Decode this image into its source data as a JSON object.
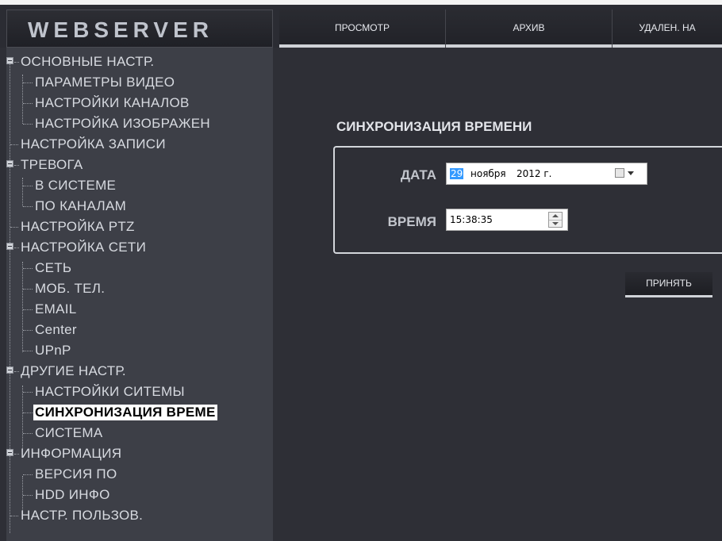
{
  "app": {
    "logo_text": "WEBSERVER"
  },
  "nav": {
    "tabs": [
      {
        "label": "ПРОСМОТР"
      },
      {
        "label": "АРХИВ"
      },
      {
        "label": "УДАЛЕН. НА"
      }
    ]
  },
  "sidebar": {
    "items": [
      {
        "label": "ОСНОВНЫЕ НАСТР."
      },
      {
        "label": "ПАРАМЕТРЫ ВИДЕО"
      },
      {
        "label": "НАСТРОЙКИ КАНАЛОВ"
      },
      {
        "label": "НАСТРОЙКА ИЗОБРАЖЕН"
      },
      {
        "label": "НАСТРОЙКА ЗАПИСИ"
      },
      {
        "label": "ТРЕВОГА"
      },
      {
        "label": "В СИСТЕМЕ"
      },
      {
        "label": "ПО КАНАЛАМ"
      },
      {
        "label": "НАСТРОЙКА PTZ"
      },
      {
        "label": "НАСТРОЙКА СЕТИ"
      },
      {
        "label": "СЕТЬ"
      },
      {
        "label": "МОБ. ТЕЛ."
      },
      {
        "label": "EMAIL"
      },
      {
        "label": "Center"
      },
      {
        "label": "UPnP"
      },
      {
        "label": "ДРУГИЕ НАСТР."
      },
      {
        "label": "НАСТРОЙКИ СИТЕМЫ"
      },
      {
        "label": "СИНХРОНИЗАЦИЯ ВРЕМЕ"
      },
      {
        "label": "СИСТЕМА"
      },
      {
        "label": "ИНФОРМАЦИЯ"
      },
      {
        "label": "ВЕРСИЯ ПО"
      },
      {
        "label": "HDD ИНФО"
      },
      {
        "label": "НАСТР. ПОЛЬЗОВ."
      }
    ]
  },
  "main": {
    "title": "СИНХРОНИЗАЦИЯ ВРЕМЕНИ",
    "date_label": "ДАТА",
    "date_day": "29",
    "date_month": "ноября",
    "date_year": "2012 г.",
    "time_label": "ВРЕМЯ",
    "time_value": "15:38:35",
    "apply_label": "ПРИНЯТЬ"
  }
}
